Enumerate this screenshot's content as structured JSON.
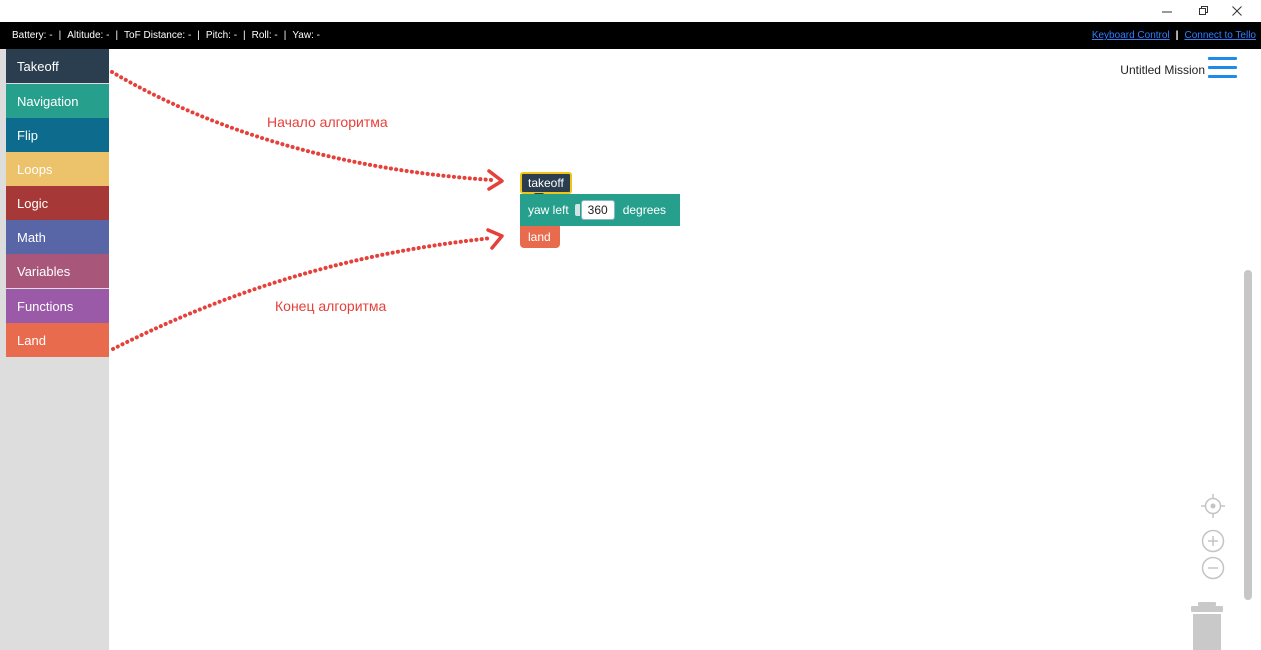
{
  "window": {
    "minimize_glyph": "–",
    "restore_glyph": "⧉",
    "close_glyph": "×"
  },
  "status": {
    "battery": "Battery: -",
    "altitude": "Altitude: -",
    "tof": "ToF Distance: -",
    "pitch": "Pitch: -",
    "roll": "Roll: -",
    "yaw": "Yaw: -",
    "separator": "|",
    "keyboard_link": "Keyboard Control",
    "connect_link": "Connect to Tello",
    "link_separator": "|"
  },
  "categories": [
    {
      "label": "Takeoff",
      "color": "#2b3e50"
    },
    {
      "label": "Navigation",
      "color": "#26a08c"
    },
    {
      "label": "Flip",
      "color": "#0d6b8e"
    },
    {
      "label": "Loops",
      "color": "#ecc36b"
    },
    {
      "label": "Logic",
      "color": "#a63838"
    },
    {
      "label": "Math",
      "color": "#5866a8"
    },
    {
      "label": "Variables",
      "color": "#a8577a"
    },
    {
      "label": "Functions",
      "color": "#9a5aa8"
    },
    {
      "label": "Land",
      "color": "#e96b4e"
    }
  ],
  "mission": {
    "title": "Untitled Mission",
    "menu_icon": "hamburger-menu-icon"
  },
  "annotations": {
    "start": "Начало алгоритма",
    "end": "Конец алгоритма",
    "arrow_color": "#e5413a"
  },
  "blocks": {
    "takeoff": "takeoff",
    "yaw_left": "yaw left",
    "yaw_value": "360",
    "yaw_unit": "degrees",
    "land": "land"
  },
  "controls": {
    "recenter_icon": "target-icon",
    "zoom_in_icon": "zoom-in-icon",
    "zoom_out_icon": "zoom-out-icon",
    "trash_icon": "trash-icon"
  }
}
